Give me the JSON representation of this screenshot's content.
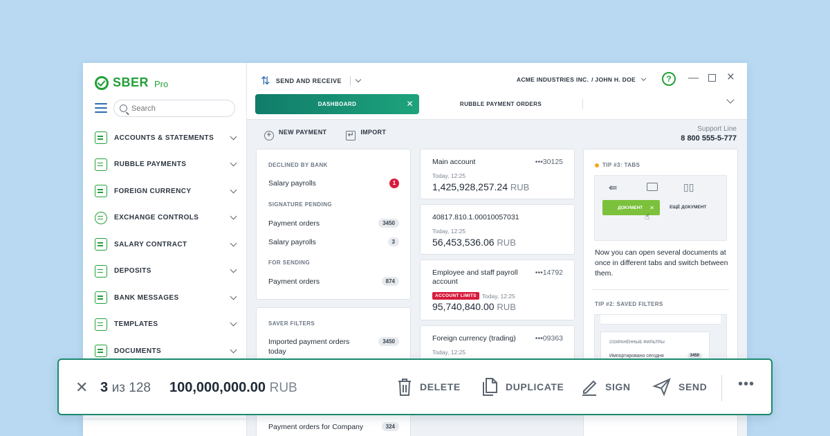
{
  "logo": {
    "brand": "SBER",
    "suffix": "Pro"
  },
  "search": {
    "placeholder": "Search"
  },
  "sidebar": {
    "items": [
      {
        "label": "ACCOUNTS & STATEMENTS"
      },
      {
        "label": "RUBBLE PAYMENTS"
      },
      {
        "label": "FOREIGN CURRENCY"
      },
      {
        "label": "EXCHANGE CONTROLS"
      },
      {
        "label": "SALARY CONTRACT"
      },
      {
        "label": "DEPOSITS"
      },
      {
        "label": "BANK MESSAGES"
      },
      {
        "label": "TEMPLATES"
      },
      {
        "label": "DOCUMENTS"
      }
    ]
  },
  "topbar": {
    "send_receive": "SEND AND RECEIVE",
    "company": "ACME INDUSTRIES INC.",
    "user": "/ JOHN H. DOE",
    "help": "?"
  },
  "tabs": [
    {
      "label": "DASHBOARD",
      "active": true
    },
    {
      "label": "RUBBLE PAYMENT ORDERS",
      "active": false
    }
  ],
  "toolbar": {
    "new_payment": "NEW PAYMENT",
    "import": "IMPORT"
  },
  "support": {
    "title": "Support Line",
    "phone": "8 800 555-5-777"
  },
  "statuses": {
    "declined_title": "DECLINED BY BANK",
    "declined": [
      {
        "label": "Salary payrolls",
        "count": "1"
      }
    ],
    "signature_title": "SIGNATURE PENDING",
    "signature": [
      {
        "label": "Payment orders",
        "count": "3450"
      },
      {
        "label": "Salary payrolls",
        "count": "3"
      }
    ],
    "sending_title": "FOR SENDING",
    "sending": [
      {
        "label": "Payment orders",
        "count": "874"
      }
    ]
  },
  "filters": {
    "title": "SAVER FILTERS",
    "items": [
      {
        "label": "Imported payment orders today",
        "count": "3450"
      },
      {
        "label": "Payment orders for Company",
        "count": "324"
      }
    ]
  },
  "accounts": [
    {
      "name": "Main account",
      "num": "•••30125",
      "date": "Today, 12:25",
      "amount": "1,425,928,257.24",
      "currency": "RUB"
    },
    {
      "name": "40817.810.1.00010057031",
      "num": "",
      "date": "Today, 12:25",
      "amount": "56,453,536.06",
      "currency": "RUB"
    },
    {
      "name": "Employee and staff payroll account",
      "num": "•••14792",
      "badge": "ACCOUNT LIMITS",
      "date": "Today, 12:25",
      "amount": "95,740,840.00",
      "currency": "RUB"
    },
    {
      "name": "Foreign currency (trading)",
      "num": "•••09363",
      "date": "Today, 12:25",
      "amount": "",
      "currency": ""
    }
  ],
  "tips": {
    "tip3_title": "TIP #3: TABS",
    "tip3_doc_tab": "ДОКУМЕНТ",
    "tip3_doc_tab2": "ЕЩЁ ДОКУМЕНТ",
    "tip3_text": "Now you can open several documents at once in different tabs and switch between them.",
    "tip2_title": "TIP #2: SAVED FILTERS",
    "tip2_filter_title": "СОХРАНЁННЫЕ ФИЛЬТРЫ",
    "tip2_filter_item": "Импортировано сегодня",
    "tip2_filter_count": "3450"
  },
  "actionbar": {
    "selected": "3",
    "of_text": "из 128",
    "sum": "100,000,000.00",
    "currency": "RUB",
    "delete": "DELETE",
    "duplicate": "DUPLICATE",
    "sign": "SIGN",
    "send": "SEND",
    "more": "•••"
  },
  "colors": {
    "brand_green": "#21a038",
    "teal": "#1a8a6e",
    "alert_red": "#d81b3c",
    "background": "#b9d9f2"
  }
}
